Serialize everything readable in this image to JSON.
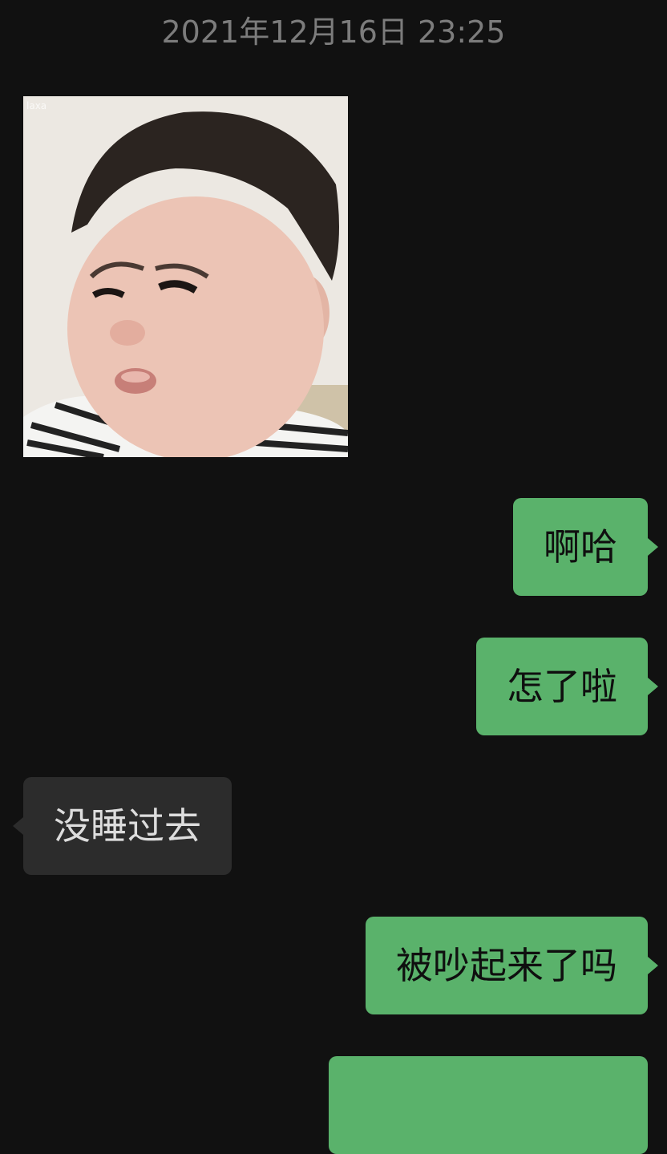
{
  "timestamp": "2021年12月16日 23:25",
  "sticker": {
    "watermark": "laxa",
    "description_icon": "baby-frown-sticker"
  },
  "messages": [
    {
      "direction": "outgoing",
      "text": "啊哈"
    },
    {
      "direction": "outgoing",
      "text": "怎了啦"
    },
    {
      "direction": "incoming",
      "text": "没睡过去"
    },
    {
      "direction": "outgoing",
      "text": "被吵起来了吗"
    },
    {
      "direction": "outgoing",
      "text": ""
    }
  ],
  "colors": {
    "background": "#111111",
    "outgoing_bubble": "#5ab26b",
    "incoming_bubble": "#2c2c2c",
    "timestamp_text": "#7c7c7c"
  }
}
